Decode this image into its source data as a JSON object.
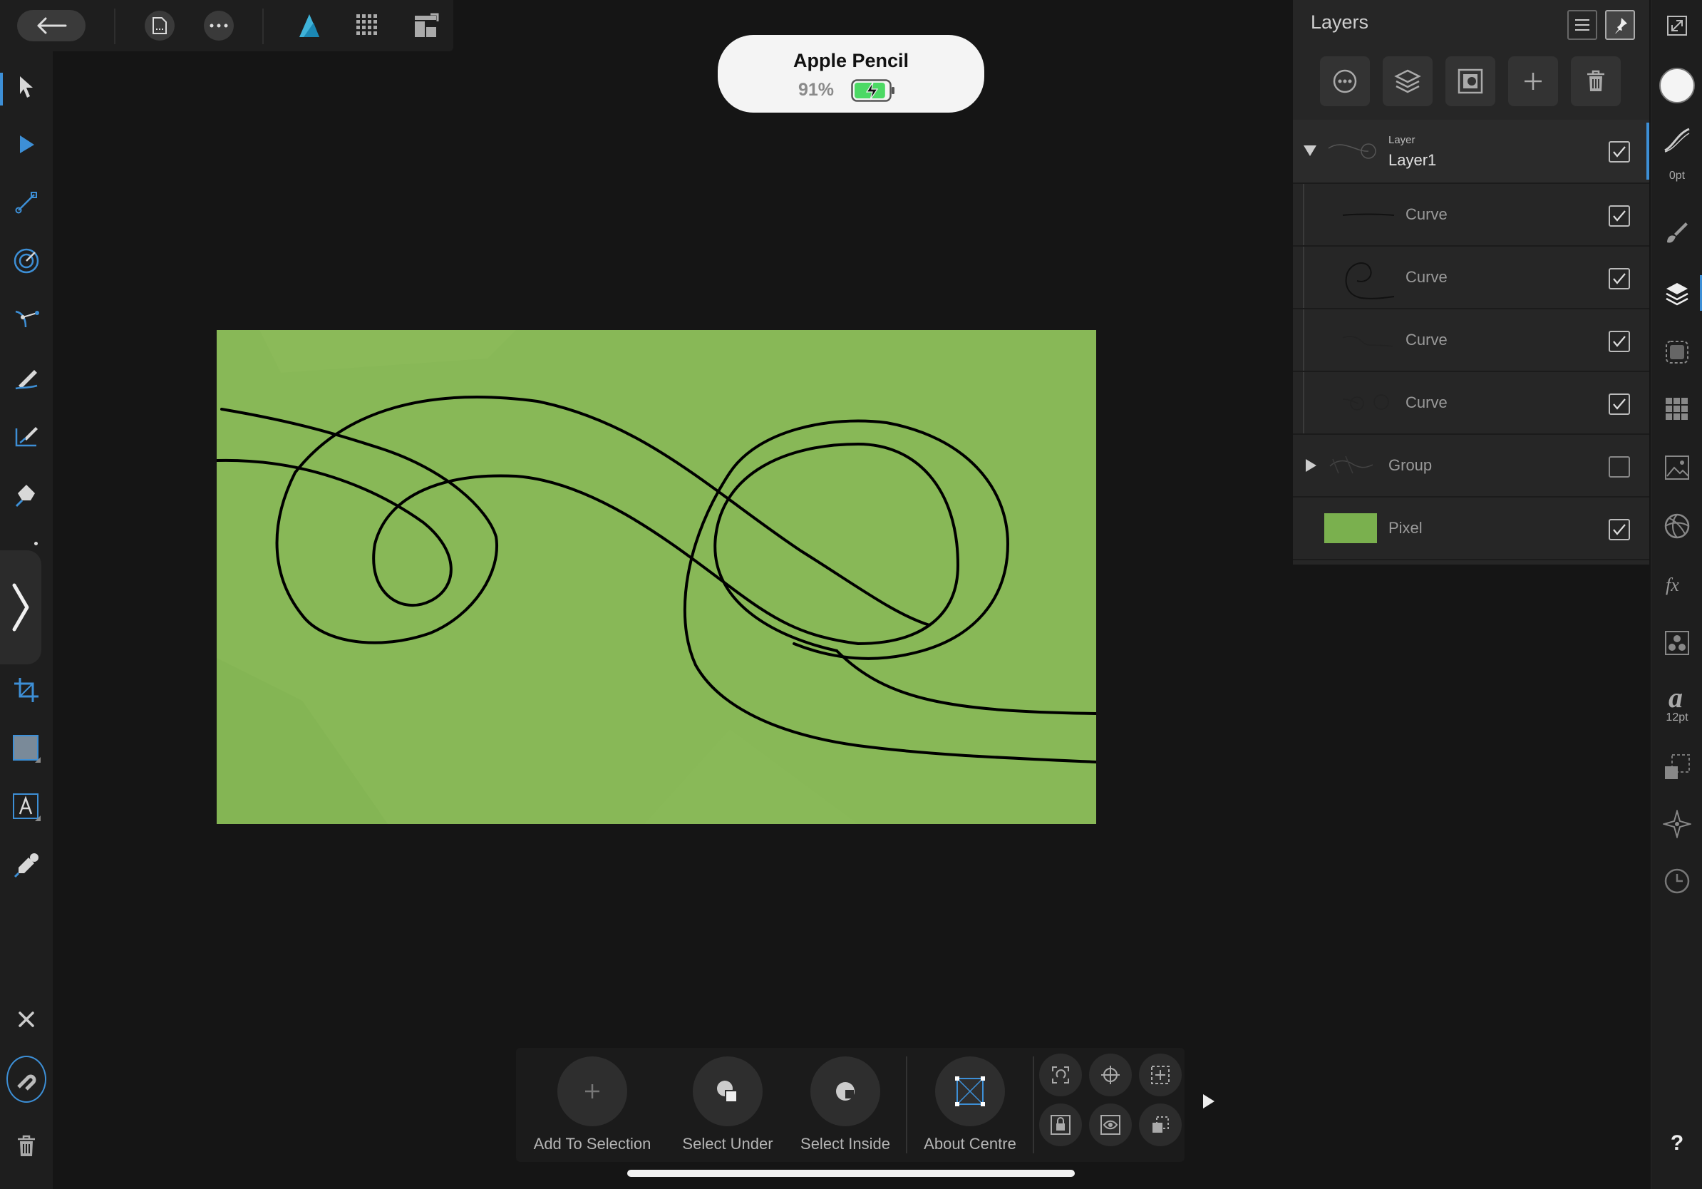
{
  "app": {
    "name": "Affinity Designer"
  },
  "top_toolbar": {
    "items": [
      "back-arrow-icon",
      "document-icon",
      "more-icon",
      "designer-persona-icon",
      "pixel-persona-icon",
      "export-persona-icon"
    ]
  },
  "pencil_hud": {
    "device": "Apple Pencil",
    "battery": "91%",
    "battery_level": 0.91
  },
  "left_tools": [
    "move-tool-icon",
    "node-tool-icon",
    "gradient-tool-icon",
    "transparency-tool-icon",
    "point-transform-tool-icon",
    "pencil-tool-icon",
    "vector-brush-tool-icon",
    "pen-tool-icon",
    "expand-tools-icon",
    "crop-tool-icon",
    "rectangle-tool-icon",
    "text-tool-icon",
    "color-picker-tool-icon",
    "close-icon",
    "snapping-icon",
    "trash-icon"
  ],
  "layers_panel": {
    "title": "Layers",
    "rows": [
      {
        "kind_label": "Layer",
        "name": "Layer1",
        "checked": true,
        "expanded": true
      },
      {
        "name": "Curve",
        "checked": true,
        "child": true
      },
      {
        "name": "Curve",
        "checked": true,
        "child": true
      },
      {
        "name": "Curve",
        "checked": true,
        "child": true
      },
      {
        "name": "Curve",
        "checked": true,
        "child": true
      },
      {
        "name": "Group",
        "checked": false,
        "expanded": false
      },
      {
        "name": "Pixel",
        "checked": true
      }
    ]
  },
  "right_studio": {
    "stroke_width": "0pt",
    "font_size": "12pt",
    "help": "?",
    "icons": [
      "fullscreen-icon",
      "color-icon",
      "stroke-icon",
      "brushes-icon",
      "layers-icon",
      "appearance-icon",
      "swatches-icon",
      "assets-icon",
      "adjustments-icon",
      "fx-icon",
      "effects-icon",
      "text-styles-icon",
      "transform-icon",
      "navigator-icon",
      "history-icon"
    ]
  },
  "context_toolbar": {
    "buttons": [
      {
        "label": "Add To Selection"
      },
      {
        "label": "Select Under"
      },
      {
        "label": "Select Inside"
      },
      {
        "label": "About Centre"
      }
    ]
  },
  "colors": {
    "canvas_fill": "#88b857",
    "accent": "#3d8fd6",
    "pixel_swatch": "#7ab04e"
  }
}
